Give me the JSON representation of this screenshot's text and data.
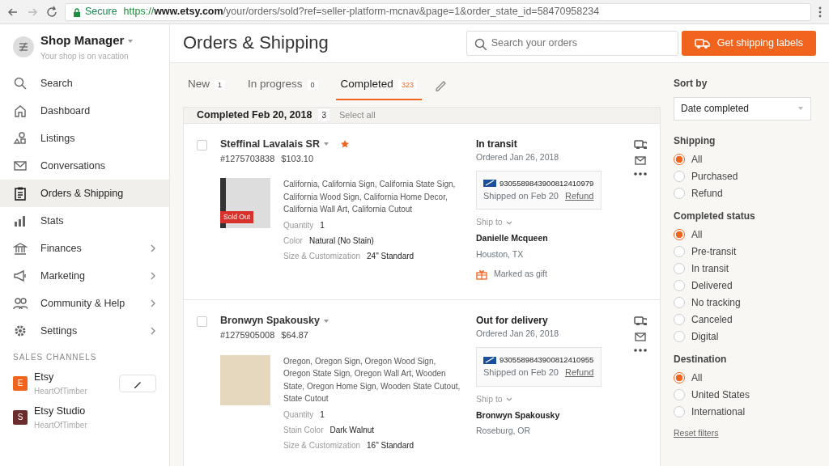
{
  "browser": {
    "secure_label": "Secure",
    "url_scheme": "https://",
    "url_host": "www.etsy.com",
    "url_path": "/your/orders/sold?ref=seller-platform-mcnav&page=1&order_state_id=58470958234"
  },
  "shop": {
    "title": "Shop Manager",
    "subtitle": "Your shop is on vacation"
  },
  "sidebar": {
    "items": [
      {
        "label": "Search",
        "kind": "search",
        "selected": false,
        "submenu": false
      },
      {
        "label": "Dashboard",
        "kind": "home",
        "selected": false,
        "submenu": false
      },
      {
        "label": "Listings",
        "kind": "shapes",
        "selected": false,
        "submenu": false
      },
      {
        "label": "Conversations",
        "kind": "mail",
        "selected": false,
        "submenu": false
      },
      {
        "label": "Orders & Shipping",
        "kind": "clipboard",
        "selected": true,
        "submenu": false
      },
      {
        "label": "Stats",
        "kind": "bars",
        "selected": false,
        "submenu": false
      },
      {
        "label": "Finances",
        "kind": "bank",
        "selected": false,
        "submenu": true
      },
      {
        "label": "Marketing",
        "kind": "megaphone",
        "selected": false,
        "submenu": true
      },
      {
        "label": "Community & Help",
        "kind": "people",
        "selected": false,
        "submenu": true
      },
      {
        "label": "Settings",
        "kind": "gear",
        "selected": false,
        "submenu": true
      }
    ],
    "channels_heading": "SALES CHANNELS",
    "channels": [
      {
        "initial": "E",
        "name": "Etsy",
        "shop": "HeartOfTimber",
        "color": "#f1641e",
        "editable": true
      },
      {
        "initial": "S",
        "name": "Etsy Studio",
        "shop": "HeartOfTimber",
        "color": "#6b2c2c",
        "editable": false
      }
    ]
  },
  "page_title": "Orders & Shipping",
  "search": {
    "placeholder": "Search your orders"
  },
  "shipping_button": "Get shipping labels",
  "tabs": [
    {
      "label": "New",
      "count": "1",
      "selected": false
    },
    {
      "label": "In progress",
      "count": "0",
      "selected": false
    },
    {
      "label": "Completed",
      "count": "323",
      "selected": true
    }
  ],
  "group": {
    "title": "Completed Feb 20, 2018",
    "count": "3",
    "select_all": "Select all"
  },
  "orders": [
    {
      "buyer": "Steffinal Lavalais SR",
      "starred": true,
      "checked": false,
      "number": "#1275703838",
      "total": "$103.10",
      "sold_out": "Sold Out",
      "title": "California, California Sign, California State Sign, California Wood Sign, California Home Decor, California Wall Art, California Cutout",
      "attributes": [
        {
          "label": "Quantity",
          "value": "1"
        },
        {
          "label": "Color",
          "value": "Natural (No Stain)"
        },
        {
          "label": "Size & Customization",
          "value": "24\" Standard"
        }
      ],
      "status": "In transit",
      "ordered": "Ordered Jan 26, 2018",
      "tracking": "9305589843900812410979",
      "shipped": "Shipped on Feb 20",
      "refund": "Refund",
      "ship_to": "Ship to",
      "recipient": "Danielle Mcqueen",
      "city": "Houston, TX",
      "gift": "Marked as gift"
    },
    {
      "buyer": "Bronwyn Spakousky",
      "starred": false,
      "checked": false,
      "number": "#1275905008",
      "total": "$64.87",
      "title": "Oregon, Oregon Sign, Oregon Wood Sign, Oregon State Sign, Oregon Wall Art, Wooden State, Oregon Home Sign, Wooden State Cutout, State Cutout",
      "attributes": [
        {
          "label": "Quantity",
          "value": "1"
        },
        {
          "label": "Stain Color",
          "value": "Dark Walnut"
        },
        {
          "label": "Size & Customization",
          "value": "16\" Standard"
        }
      ],
      "status": "Out for delivery",
      "ordered": "Ordered Jan 26, 2018",
      "tracking": "9305589843900812410955",
      "shipped": "Shipped on Feb 20",
      "refund": "Refund",
      "ship_to": "Ship to",
      "recipient": "Bronwyn Spakousky",
      "city": "Roseburg, OR"
    }
  ],
  "filters": {
    "sort_label": "Sort by",
    "sort_value": "Date completed",
    "groups": [
      {
        "title": "Shipping",
        "options": [
          {
            "label": "All",
            "selected": true
          },
          {
            "label": "Purchased",
            "selected": false
          },
          {
            "label": "Refund",
            "selected": false
          }
        ]
      },
      {
        "title": "Completed status",
        "options": [
          {
            "label": "All",
            "selected": true
          },
          {
            "label": "Pre-transit",
            "selected": false
          },
          {
            "label": "In transit",
            "selected": false
          },
          {
            "label": "Delivered",
            "selected": false
          },
          {
            "label": "No tracking",
            "selected": false
          },
          {
            "label": "Canceled",
            "selected": false
          },
          {
            "label": "Digital",
            "selected": false
          }
        ]
      },
      {
        "title": "Destination",
        "options": [
          {
            "label": "All",
            "selected": true
          },
          {
            "label": "United States",
            "selected": false
          },
          {
            "label": "International",
            "selected": false
          }
        ]
      }
    ],
    "reset": "Reset filters"
  }
}
